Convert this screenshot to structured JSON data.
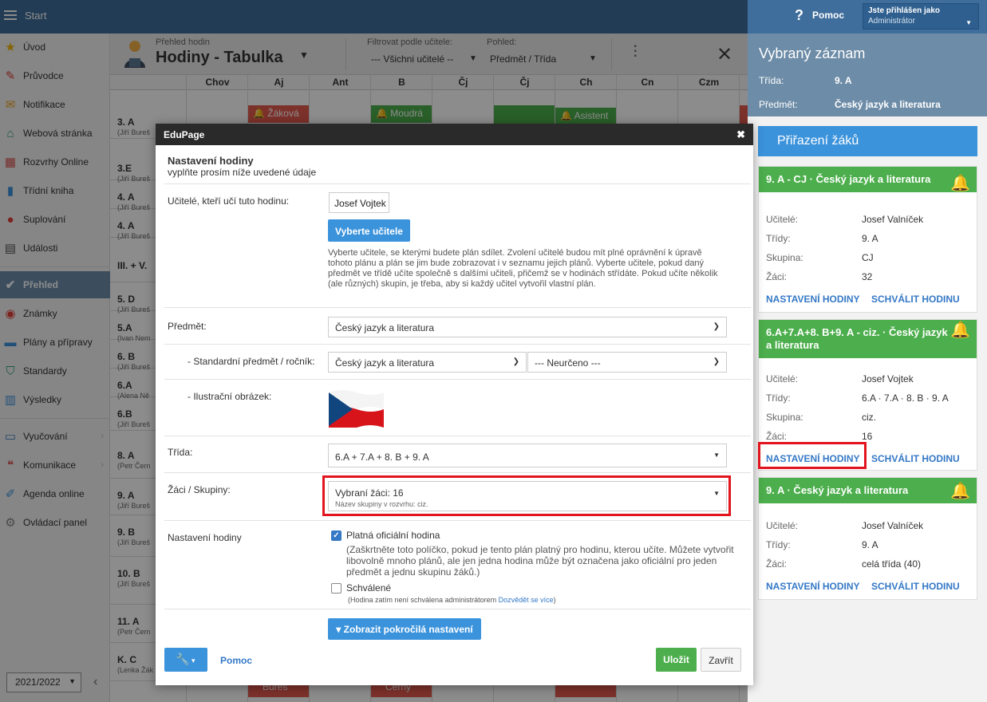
{
  "topbar": {
    "start": "Start",
    "help": "Pomoc",
    "user_line1": "Jste přihlášen jako",
    "user_line2": "Administrátor"
  },
  "sidebar": {
    "items": [
      {
        "label": "Úvod",
        "icon": "star-icon"
      },
      {
        "label": "Průvodce",
        "icon": "magic-wand-icon"
      },
      {
        "label": "Notifikace",
        "icon": "envelope-icon"
      },
      {
        "label": "Webová stránka",
        "icon": "home-icon"
      },
      {
        "label": "Rozvrhy Online",
        "icon": "timetable-icon"
      },
      {
        "label": "Třídní kniha",
        "icon": "book-icon"
      },
      {
        "label": "Suplování",
        "icon": "substitute-icon"
      },
      {
        "label": "Události",
        "icon": "calendar-icon"
      },
      {
        "label": "Přehled",
        "icon": "check-circle-icon"
      },
      {
        "label": "Známky",
        "icon": "grades-icon"
      },
      {
        "label": "Plány a přípravy",
        "icon": "briefcase-icon"
      },
      {
        "label": "Standardy",
        "icon": "shield-icon"
      },
      {
        "label": "Výsledky",
        "icon": "bar-chart-icon"
      },
      {
        "label": "Vyučování",
        "icon": "open-book-icon"
      },
      {
        "label": "Komunikace",
        "icon": "chat-icon"
      },
      {
        "label": "Agenda online",
        "icon": "pen-icon"
      },
      {
        "label": "Ovládací panel",
        "icon": "gear-icon"
      }
    ],
    "year": "2021/2022"
  },
  "main": {
    "subtitle": "Přehled hodin",
    "title": "Hodiny - Tabulka",
    "filter_label": "Filtrovat podle učitele:",
    "filter_value": "--- Všichni učitelé --",
    "view_label": "Pohled:",
    "view_value": "Předmět / Třída",
    "columns": [
      "Chov",
      "Aj",
      "Ant",
      "B",
      "Čj",
      "Čj",
      "Ch",
      "Cn",
      "Czm"
    ],
    "rows": [
      {
        "label": "3. A",
        "sub": "(Jiří Bureš"
      },
      {
        "label": "3.E",
        "sub": "(Jiří Bureš"
      },
      {
        "label": "4. A",
        "sub": "(Jiří Bureš"
      },
      {
        "label": "4. A",
        "sub": "(Jiří Bureš"
      },
      {
        "label": "III. + V.",
        "sub": ""
      },
      {
        "label": "5. D",
        "sub": "(Jiří Bureš"
      },
      {
        "label": "5.A",
        "sub": "(Ivan Nem"
      },
      {
        "label": "6. B",
        "sub": "(Jiří Bureš"
      },
      {
        "label": "6.A",
        "sub": "(Alena Ně"
      },
      {
        "label": "6.B",
        "sub": "(Jiří Bureš"
      },
      {
        "label": "8. A",
        "sub": "(Petr Čern"
      },
      {
        "label": "9. A",
        "sub": "(Jiří Bureš"
      },
      {
        "label": "9. B",
        "sub": "(Jiří Bureš"
      },
      {
        "label": "10. B",
        "sub": "(Jiří Bureš"
      },
      {
        "label": "11. A",
        "sub": "(Petr Čern"
      },
      {
        "label": "K. C",
        "sub": "(Lenka Žák"
      }
    ],
    "cells": {
      "c1": "Žáková",
      "c2": "Moudrá",
      "c3": "Asistent",
      "c4": "Bureš",
      "c5": "Černý"
    }
  },
  "right": {
    "title": "Vybraný záznam",
    "class_key": "Třída:",
    "class_val": "9. A",
    "subject_key": "Předmět:",
    "subject_val": "Český jazyk a literatura",
    "assign": "Přiřazení žáků",
    "cards": [
      {
        "title": "9. A - CJ · Český jazyk a literatura",
        "k1": "Učitelé:",
        "v1": "Josef Valníček",
        "k2": "Třídy:",
        "v2": "9. A",
        "k3": "Skupina:",
        "v3": "CJ",
        "k4": "Žáci:",
        "v4": "32",
        "a1": "NASTAVENÍ HODINY",
        "a2": "SCHVÁLIT HODINU"
      },
      {
        "title": "6.A+7.A+8. B+9. A - ciz. · Český jazyk a literatura",
        "k1": "Učitelé:",
        "v1": "Josef Vojtek",
        "k2": "Třídy:",
        "v2": "6.A · 7.A · 8. B · 9. A",
        "k3": "Skupina:",
        "v3": "ciz.",
        "k4": "Žáci:",
        "v4": "16",
        "a1": "NASTAVENÍ HODINY",
        "a2": "SCHVÁLIT HODINU"
      },
      {
        "title": "9. A · Český jazyk a literatura",
        "k1": "Učitelé:",
        "v1": "Josef Valníček",
        "k2": "Třídy:",
        "v2": "9. A",
        "k3": "Žáci:",
        "v3": "celá třída (40)",
        "a1": "NASTAVENÍ HODINY",
        "a2": "SCHVÁLIT HODINU"
      }
    ]
  },
  "modal": {
    "window_title": "EduPage",
    "heading": "Nastavení hodiny",
    "subheading": "vyplňte prosím níže uvedené údaje",
    "teachers_label": "Učitelé, kteří učí tuto hodinu:",
    "teacher_value": "Josef Vojtek",
    "choose_teachers": "Vyberte učitele",
    "teachers_note": "Vyberte učitele, se kterými budete plán sdílet. Zvolení učitelé budou mít plné oprávnění k úpravě tohoto plánu a plán se jim bude zobrazovat i v seznamu jejich plánů. Vyberte učitele, pokud daný předmět ve třídě učíte společně s dalšími učiteli, přičemž se v hodinách střídáte. Pokud učíte několik (ale různých) skupin, je třeba, aby si každý učitel vytvořil vlastní plán.",
    "subject_label": "Předmět:",
    "subject_value": "Český jazyk a literatura",
    "std_label": "- Standardní předmět / ročník:",
    "std_subject": "Český jazyk a literatura",
    "std_grade": "--- Neurčeno ---",
    "image_label": "- Ilustrační obrázek:",
    "class_label": "Třída:",
    "class_value": "6.A + 7.A + 8. B + 9. A",
    "students_label": "Žáci / Skupiny:",
    "students_value": "Vybraní žáci: 16",
    "students_sub": "Název skupiny v rozvrhu: ciz.",
    "settings_label": "Nastavení hodiny",
    "official_label": "Platná oficiální hodina",
    "official_note": "(Zaškrtněte toto políčko, pokud je tento plán platný pro hodinu, kterou učíte. Můžete vytvořit libovolně mnoho plánů, ale jen jedna hodina může být označena jako oficiální pro jeden předmět a jednu skupinu žáků.)",
    "approved_label": "Schválené",
    "approved_note": "(Hodina zatím není schválena administrátorem",
    "approved_link": "Dozvědět se více",
    "advanced": "Zobrazit pokročilá nastavení",
    "help": "Pomoc",
    "save": "Uložit",
    "close": "Zavřít"
  },
  "colors": {
    "accent": "#3b93dc",
    "green": "#4cae4c",
    "red": "#e45a4f",
    "highlight": "#e2151e"
  }
}
